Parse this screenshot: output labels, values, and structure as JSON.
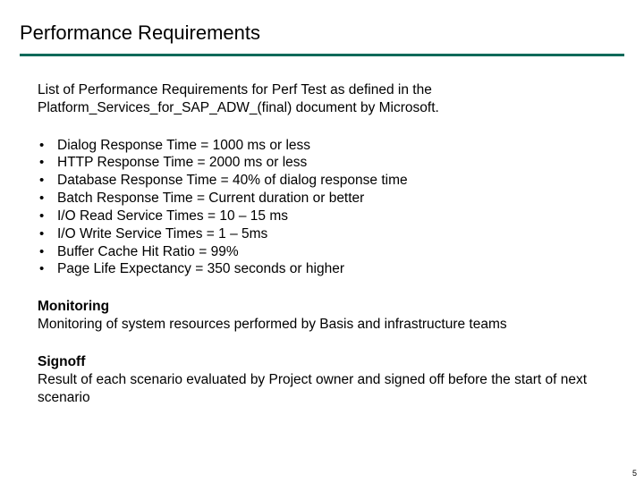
{
  "title": "Performance Requirements",
  "intro": "List of Performance Requirements for Perf Test as defined in the Platform_Services_for_SAP_ADW_(final) document by Microsoft.",
  "requirements": [
    "Dialog Response Time = 1000 ms or less",
    "HTTP Response Time = 2000 ms or less",
    "Database Response Time = 40% of dialog response time",
    "Batch Response Time = Current duration or better",
    "I/O Read Service Times = 10 – 15 ms",
    "I/O Write Service Times = 1 – 5ms",
    "Buffer Cache Hit Ratio = 99%",
    "Page Life Expectancy = 350 seconds or higher"
  ],
  "monitoring": {
    "heading": "Monitoring",
    "text": "Monitoring of system resources performed by Basis and infrastructure teams"
  },
  "signoff": {
    "heading": "Signoff",
    "text": "Result of each scenario evaluated by Project owner and signed off before the start of next scenario"
  },
  "page_number": "5"
}
